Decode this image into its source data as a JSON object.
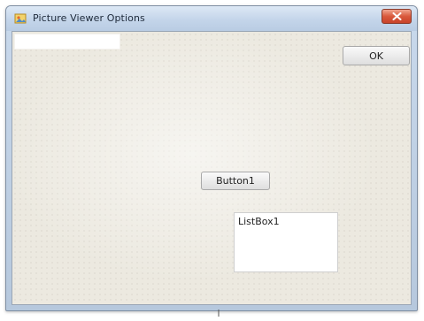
{
  "window": {
    "title": "Picture Viewer Options",
    "icon": "app-icon",
    "close_icon": "close-icon"
  },
  "form": {
    "textbox_value": "",
    "ok_label": "OK",
    "button1_label": "Button1",
    "listbox_items": [
      "ListBox1"
    ]
  },
  "colors": {
    "titlebar": "#c4d5ea",
    "client_background": "#ece9e0",
    "close_button": "#d9593c"
  }
}
